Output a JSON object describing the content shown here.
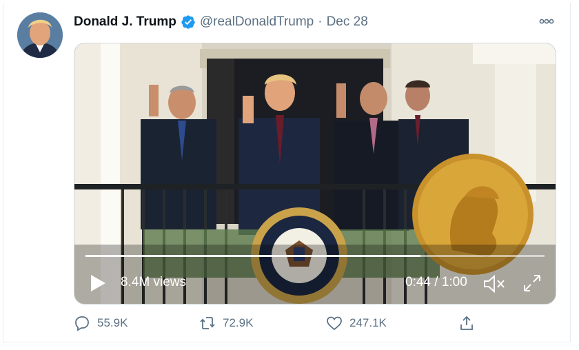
{
  "tweet": {
    "author_name": "Donald J. Trump",
    "handle": "@realDonaldTrump",
    "separator": "·",
    "date": "Dec 28"
  },
  "video": {
    "views": "8.4M views",
    "time": "0:44 / 1:00",
    "progress": 0.73
  },
  "actions": {
    "reply_count": "55.9K",
    "retweet_count": "72.9K",
    "like_count": "247.1K"
  },
  "colors": {
    "verified": "#1d9bf0",
    "muted_text": "#5b7083"
  },
  "icons": [
    "verified-badge-icon",
    "more-icon",
    "play-icon",
    "mute-icon",
    "fullscreen-icon",
    "reply-icon",
    "retweet-icon",
    "like-icon",
    "share-icon"
  ]
}
